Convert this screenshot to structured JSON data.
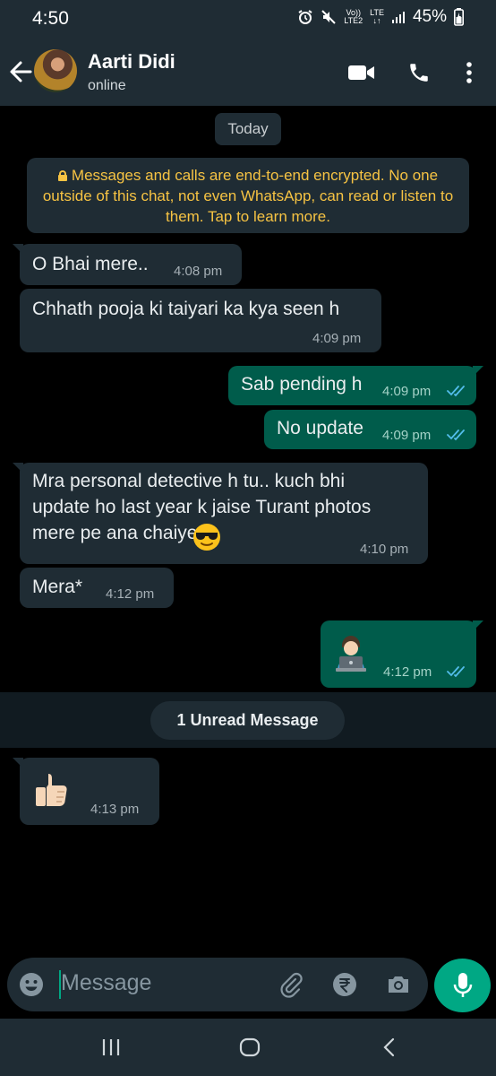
{
  "status_bar": {
    "time": "4:50",
    "network_top": "Vo))",
    "network_bottom": "LTE2",
    "lte_label": "LTE",
    "battery": "45%"
  },
  "header": {
    "name": "Aarti Didi",
    "status": "online"
  },
  "chat": {
    "date_chip": "Today",
    "encryption_notice": "Messages and calls are end-to-end encrypted. No one outside of this chat, not even WhatsApp, can read or listen to them. Tap to learn more.",
    "messages": [
      {
        "direction": "in",
        "text": "O Bhai mere..",
        "time": "4:08 pm"
      },
      {
        "direction": "in",
        "text": "Chhath pooja ki taiyari ka kya seen h",
        "time": "4:09 pm"
      },
      {
        "direction": "out",
        "text": "Sab pending h",
        "time": "4:09 pm",
        "status": "read"
      },
      {
        "direction": "out",
        "text": "No update",
        "time": "4:09 pm",
        "status": "read"
      },
      {
        "direction": "in",
        "text": "Mra personal detective h tu.. kuch bhi\nupdate ho last year k jaise Turant photos\nmere pe ana chaiye",
        "emoji": "sunglasses-face",
        "time": "4:10 pm"
      },
      {
        "direction": "in",
        "text": "Mera*",
        "time": "4:12 pm"
      },
      {
        "direction": "out",
        "emoji": "technologist-laptop",
        "time": "4:12 pm",
        "status": "read"
      },
      {
        "direction": "in",
        "emoji": "thumbs-up",
        "time": "4:13 pm"
      }
    ],
    "unread_chip": "1 Unread Message"
  },
  "composer": {
    "placeholder": "Message"
  },
  "icons": {
    "video_call": "video-call-icon",
    "voice_call": "phone-icon",
    "menu": "more-vert-icon",
    "attach": "paperclip-icon",
    "payment": "rupee-icon",
    "camera": "camera-icon",
    "mic": "mic-icon",
    "emoji": "emoji-icon"
  },
  "colors": {
    "header_bg": "#1f2c34",
    "incoming_bubble": "#1f2c34",
    "outgoing_bubble": "#005c4b",
    "accent": "#00a884",
    "encryption_text": "#f6c343",
    "read_ticks": "#53bdeb"
  }
}
